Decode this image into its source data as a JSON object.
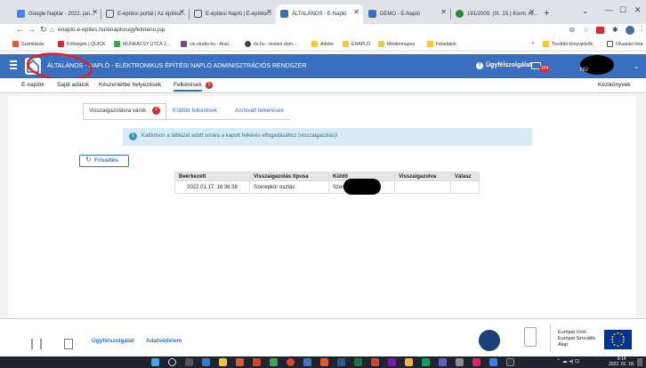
{
  "browser": {
    "tabs": [
      {
        "label": "Google Naptár - 2022. jan...",
        "color": "#4285f4"
      },
      {
        "label": "E-építési portál | Az építési...",
        "color": "#555"
      },
      {
        "label": "E-építési Napló | E-építési...",
        "color": "#555"
      },
      {
        "label": "ÁLTALÁNOS - E-Napló",
        "color": "#3a6fbf"
      },
      {
        "label": "DEMO - E-Napló",
        "color": "#3a6fbf"
      },
      {
        "label": "191/2009. (IX. 15.) Korm. re...",
        "color": "#2a8a3a"
      }
    ],
    "url": "enaplo.e-epites.hu/enaplo/ugyfelmenu.jsp",
    "bookmarks": [
      "Számlázás",
      "Költségek | QUICK",
      "MUNKÁCSY UTCA 2...",
      "vis-studio.hu - Anal...",
      "tlu.hu - instant dom...",
      "Adobe",
      "ENAPLÓ",
      "Mindennapos",
      "Feladatok"
    ],
    "bookmarks_right": [
      "További könyvjelzők",
      "Olvasási lista"
    ]
  },
  "app": {
    "title_prefix": "ÁLTALÁNOS - ",
    "title_rest": "NAPLÓ - ELEKTRONIKUS ÉPÍTÉSI NAPLÓ ADMINISZTRÁCIÓS RENDSZER",
    "support": "Ügyfélszolgálat",
    "mail_count": "324",
    "user_partial": "NÚ"
  },
  "menu": {
    "items": [
      "E-naplók",
      "Saját adatok",
      "Készenlétbe helyezések",
      "Felkérések"
    ],
    "felkeresek_badge": "!",
    "right": "Kézikönyvek"
  },
  "subtabs": {
    "items": [
      "Visszaigazolásra várók",
      "Küldött felkérések",
      "Archivált felkérések"
    ],
    "badge": "!"
  },
  "info": "Kattintson a táblázat adott sorára a kapott felkérés elfogadásához (visszaigazolás)!",
  "refresh": "Frissítés",
  "table": {
    "headers": [
      "Beérkezett",
      "Visszaigazolás típusa",
      "Küldő",
      "Visszaigazolva",
      "Válasz"
    ],
    "rows": [
      [
        "2022.01.17. 18:36:38",
        "Szerepkör osztás",
        "Szer",
        "",
        ""
      ]
    ]
  },
  "footer": {
    "links": [
      "Ügyfélszolgálat",
      "Adatvédelem"
    ],
    "eu": [
      "Európai Unió",
      "Európai Szociális",
      "Alap"
    ]
  },
  "taskbar": {
    "time": "9:14",
    "date": "2022. 01. 18."
  },
  "colors": {
    "brand": "#3a6fbf",
    "badge": "#d32f2f",
    "info_bg": "#d7ecf6"
  }
}
